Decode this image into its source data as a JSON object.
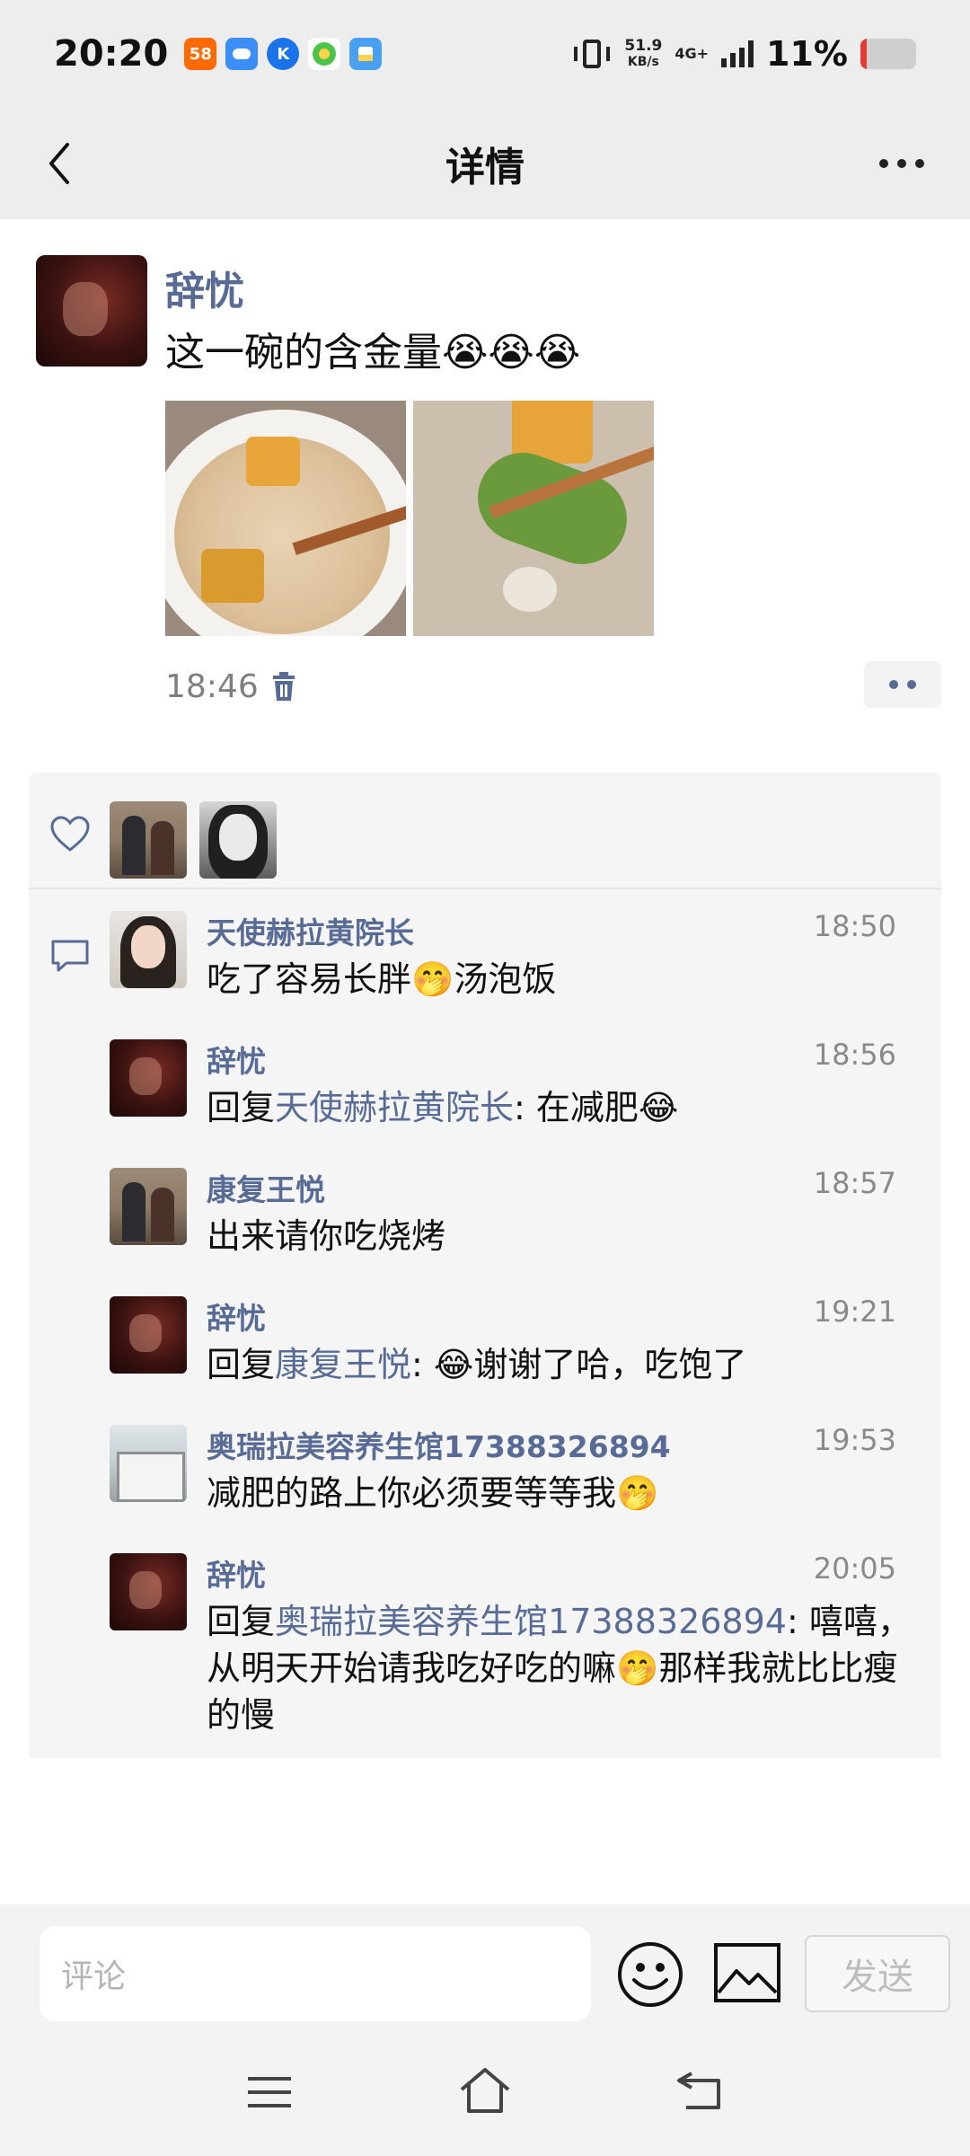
{
  "status_bar": {
    "time": "20:20",
    "apps": [
      {
        "icon": "58-app-icon",
        "label": "58",
        "color": "#ff6a00"
      },
      {
        "icon": "chat-app-icon",
        "label": "",
        "color": "#3a8ef6"
      },
      {
        "icon": "k-app-icon",
        "label": "K",
        "color": "#1a73e8"
      },
      {
        "icon": "green-app-icon",
        "label": "",
        "color": "#4cc44a"
      },
      {
        "icon": "files-app-icon",
        "label": "",
        "color": "#4aa0f0"
      }
    ],
    "net_speed_value": "51.9",
    "net_speed_unit": "KB/s",
    "network_type": "4G+",
    "battery_percent": "11%",
    "battery_level": 0.11
  },
  "nav": {
    "title": "详情"
  },
  "post": {
    "author": "辞忧",
    "text": "这一碗的含金量😭😭😭",
    "time": "18:46"
  },
  "likes": {
    "avatars": [
      "couple-avatar",
      "bw-avatar"
    ]
  },
  "comments": [
    {
      "name": "天使赫拉黄院长",
      "time": "18:50",
      "reply_to": "",
      "text": "吃了容易长胖🤭汤泡饭",
      "avatar": "av-girl"
    },
    {
      "name": "辞忧",
      "time": "18:56",
      "reply_to": "天使赫拉黄院长",
      "text": ": 在减肥😂",
      "avatar": "av-red"
    },
    {
      "name": "康复王悦",
      "time": "18:57",
      "reply_to": "",
      "text": "出来请你吃烧烤",
      "avatar": "av-couple"
    },
    {
      "name": "辞忧",
      "time": "19:21",
      "reply_to": "康复王悦",
      "text": ": 😂谢谢了哈，吃饱了",
      "avatar": "av-red"
    },
    {
      "name": "奥瑞拉美容养生馆17388326894",
      "time": "19:53",
      "reply_to": "",
      "text": "减肥的路上你必须要等等我🤭",
      "avatar": "av-shop"
    },
    {
      "name": "辞忧",
      "time": "20:05",
      "reply_to": "奥瑞拉美容养生馆17388326894",
      "text": ": 嘻嘻，从明天开始请我吃好吃的嘛🤭那样我就比比瘦的慢",
      "avatar": "av-red"
    }
  ],
  "reply_prefix": "回复",
  "input": {
    "placeholder": "评论",
    "send_label": "发送"
  }
}
